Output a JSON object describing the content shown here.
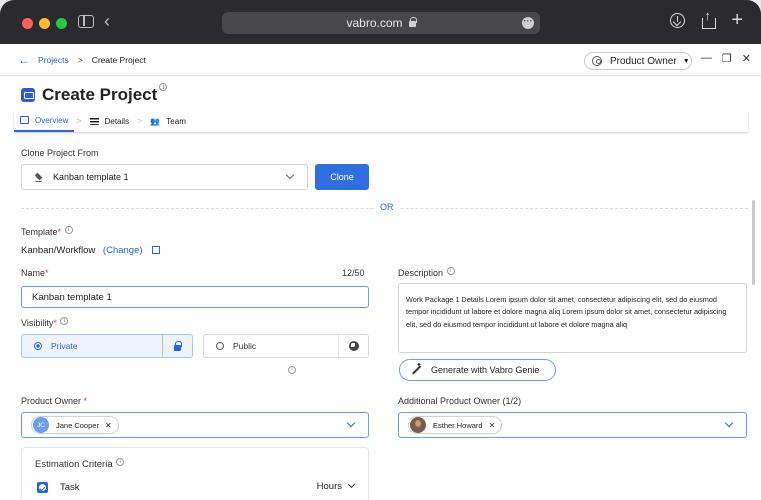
{
  "browser": {
    "url": "vabro.com"
  },
  "breadcrumb": {
    "projects": "Projects",
    "separator": ">",
    "current": "Create Project"
  },
  "role": {
    "label": "Product Owner",
    "caret": "▼"
  },
  "window_controls": {
    "minimize": "—",
    "restore": "❐",
    "close": "✕"
  },
  "page": {
    "title": "Create Project"
  },
  "steps": [
    {
      "label": "Overview"
    },
    {
      "label": "Details"
    },
    {
      "label": "Team"
    }
  ],
  "clone": {
    "label": "Clone Project From",
    "selected": "Kanban template 1",
    "button": "Clone"
  },
  "or_text": "OR",
  "template": {
    "label": "Template",
    "value": "Kanban/Workflow",
    "change": "(Change)"
  },
  "name": {
    "label": "Name",
    "value": "Kanban template 1",
    "counter": "12/50"
  },
  "visibility": {
    "label": "Visibility",
    "options": [
      "Private",
      "Public"
    ],
    "selected": "Private"
  },
  "description": {
    "label": "Description",
    "value": "Work Package 1 Details Lorem ipsum dolor sit amet, consectetur adipiscing elit, sed do eiusmod tempor incididunt ut labore et dolore magna aliq Lorem ipsum dolor sit amet, consectetur adipiscing elit, sed do eiusmod tempor incididunt ut labore et dolore magna aliq"
  },
  "genie": {
    "label": "Generate with Vabro Genie"
  },
  "product_owner": {
    "label": "Product Owner",
    "chip": {
      "initials": "JC",
      "name": "Jane Cooper"
    }
  },
  "additional_owner": {
    "label": "Additional Product Owner (1/2)",
    "chip": {
      "name": "Esther Howard"
    }
  },
  "estimation": {
    "label": "Estimation Criteria",
    "task": "Task",
    "unit": "Hours"
  },
  "required_mark": "*",
  "remove_mark": "✕",
  "colors": {
    "accent": "#2563eb",
    "button": "#2f6fe0",
    "required": "#e23b3b",
    "chrome": "#2b2b2d"
  }
}
